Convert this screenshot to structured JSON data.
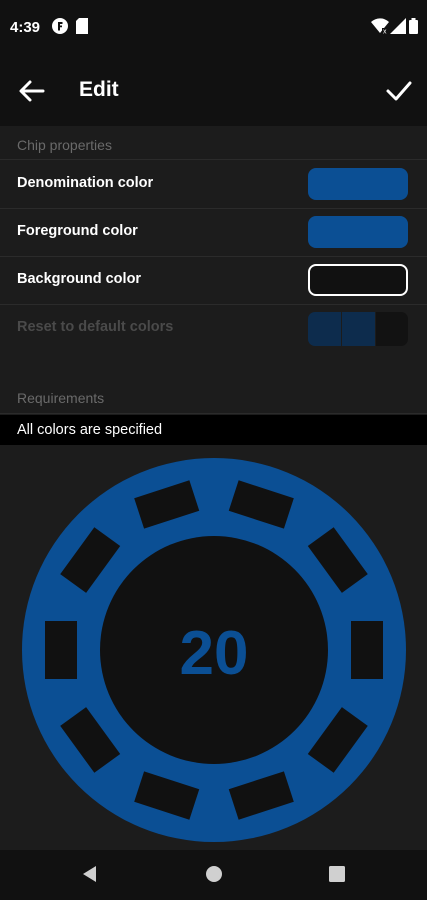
{
  "status": {
    "time": "4:39"
  },
  "app_bar": {
    "title": "Edit"
  },
  "chip_properties": {
    "header": "Chip properties",
    "rows": [
      {
        "label": "Denomination color"
      },
      {
        "label": "Foreground color"
      },
      {
        "label": "Background color"
      },
      {
        "label": "Reset to default colors"
      }
    ]
  },
  "requirements": {
    "header": "Requirements",
    "status": "All colors are specified"
  },
  "chip_preview": {
    "denomination": "20",
    "denomination_color": "#0b4f94",
    "foreground_color": "#0b4f94",
    "background_color": "#111111"
  },
  "colors": {
    "accent": "#0b4f94",
    "background": "#1c1c1c",
    "bar": "#111111"
  },
  "icons": {
    "status_left": [
      "f-logo-icon",
      "sd-card-icon"
    ],
    "status_right": [
      "wifi-icon",
      "signal-icon",
      "battery-icon"
    ],
    "app_bar": [
      "arrow-back-icon",
      "check-icon"
    ],
    "nav": [
      "back-triangle-icon",
      "home-circle-icon",
      "recents-square-icon"
    ]
  }
}
